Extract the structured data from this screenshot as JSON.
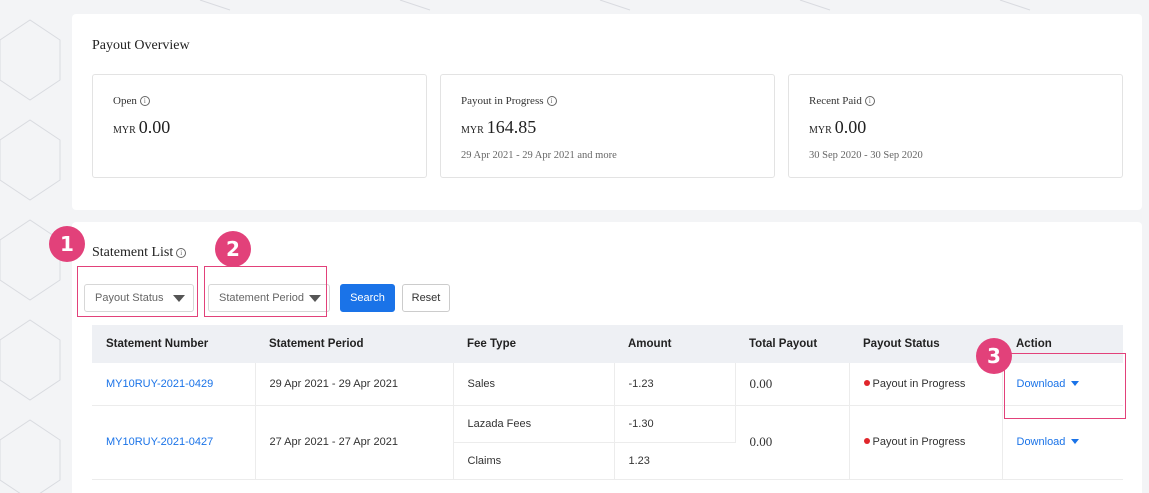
{
  "overview": {
    "title": "Payout Overview",
    "info_glyph": "i",
    "cards": [
      {
        "label": "Open",
        "currency": "MYR",
        "amount": "0.00",
        "period": ""
      },
      {
        "label": "Payout in Progress",
        "currency": "MYR",
        "amount": "164.85",
        "period": "29 Apr 2021 - 29 Apr 2021 and more"
      },
      {
        "label": "Recent Paid",
        "currency": "MYR",
        "amount": "0.00",
        "period": "30 Sep 2020 - 30 Sep 2020"
      }
    ]
  },
  "statement_list": {
    "title": "Statement List",
    "filters": {
      "payout_status": "Payout Status",
      "statement_period": "Statement Period",
      "search_label": "Search",
      "reset_label": "Reset"
    },
    "columns": [
      "Statement Number",
      "Statement Period",
      "Fee Type",
      "Amount",
      "Total Payout",
      "Payout Status",
      "Action"
    ],
    "rows": [
      {
        "number": "MY10RUY-2021-0429",
        "period": "29 Apr 2021 - 29 Apr 2021",
        "fees": [
          {
            "type": "Sales",
            "amount": "-1.23"
          }
        ],
        "total": "0.00",
        "status": "Payout in Progress",
        "action": "Download"
      },
      {
        "number": "MY10RUY-2021-0427",
        "period": "27 Apr 2021 - 27 Apr 2021",
        "fees": [
          {
            "type": "Lazada Fees",
            "amount": "-1.30"
          },
          {
            "type": "Claims",
            "amount": "1.23"
          }
        ],
        "total": "0.00",
        "status": "Payout in Progress",
        "action": "Download"
      }
    ]
  },
  "annotations": [
    "1",
    "2",
    "3"
  ],
  "colors": {
    "accent": "#1a73e8",
    "highlight": "#e2417a",
    "status_dot": "#e0262b"
  }
}
